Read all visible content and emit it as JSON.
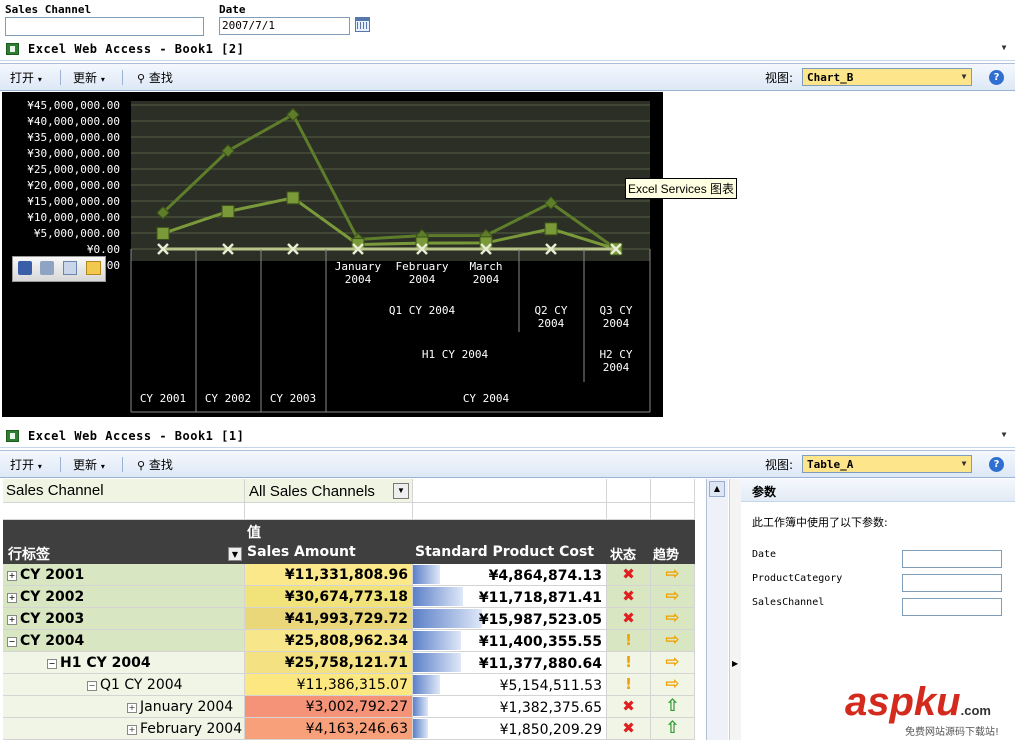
{
  "filters": {
    "sales_channel_label": "Sales Channel",
    "sales_channel_value": "",
    "date_label": "Date",
    "date_value": "2007/7/1"
  },
  "window1": {
    "title": "Excel Web Access - Book1 [2]",
    "toolbar": {
      "open": "打开",
      "refresh": "更新",
      "find": "查找",
      "view_label": "视图:",
      "view_value": "Chart_B"
    },
    "tooltip": "Excel Services 图表"
  },
  "window2": {
    "title": "Excel Web Access - Book1 [1]",
    "toolbar": {
      "open": "打开",
      "refresh": "更新",
      "find": "查找",
      "view_label": "视图:",
      "view_value": "Table_A"
    }
  },
  "chart_data": {
    "type": "line",
    "y_ticks": [
      "¥45,000,000.00",
      "¥40,000,000.00",
      "¥35,000,000.00",
      "¥30,000,000.00",
      "¥25,000,000.00",
      "¥20,000,000.00",
      "¥15,000,000.00",
      "¥10,000,000.00",
      "¥5,000,000.00",
      "¥0.00",
      "00"
    ],
    "ylim": [
      0,
      45000000
    ],
    "categories": [
      "CY 2001",
      "CY 2002",
      "CY 2003",
      "January 2004",
      "February 2004",
      "March 2004",
      "Q2 CY 2004",
      "Q3 CY 2004"
    ],
    "series": [
      {
        "marker": "diamond",
        "color": "#5e7d2a",
        "values": [
          11331808.96,
          30674773.18,
          41993729.72,
          3002792.27,
          4163246.63,
          4220276.17,
          14400000,
          50000
        ]
      },
      {
        "marker": "square",
        "color": "#7a9a3a",
        "values": [
          4864874.13,
          11718871.41,
          15987523.05,
          1382375.65,
          1850209.29,
          1921926.13,
          6300000,
          22000
        ]
      },
      {
        "marker": "x",
        "color": "#b8c48a",
        "values": [
          0,
          0,
          0,
          0,
          0,
          0,
          0,
          0
        ]
      }
    ],
    "x_level1": [
      {
        "text": "January\n2004"
      },
      {
        "text": "February\n2004"
      },
      {
        "text": "March\n2004"
      }
    ],
    "x_level2": [
      {
        "text": "Q1 CY 2004"
      },
      {
        "text": "Q2 CY\n2004"
      },
      {
        "text": "Q3 CY\n2004"
      }
    ],
    "x_level3": [
      {
        "text": "H1 CY 2004"
      },
      {
        "text": "H2 CY\n2004"
      }
    ],
    "x_level4": [
      {
        "text": "CY 2001"
      },
      {
        "text": "CY 2002"
      },
      {
        "text": "CY 2003"
      },
      {
        "text": "CY 2004"
      }
    ]
  },
  "table": {
    "filter_label": "Sales Channel",
    "filter_value": "All Sales Channels",
    "values_header": "值",
    "row_label_header": "行标签",
    "col_sales": "Sales Amount",
    "col_cost": "Standard Product Cost",
    "col_status": "状态",
    "col_trend": "趋势",
    "rows": [
      {
        "label": "CY 2001",
        "exp": "+",
        "sales": "¥11,331,808.96",
        "cost": "¥4,864,874.13",
        "status": "✖",
        "trend": "⇨",
        "bold": true,
        "level": 0
      },
      {
        "label": "CY 2002",
        "exp": "+",
        "sales": "¥30,674,773.18",
        "cost": "¥11,718,871.41",
        "status": "✖",
        "trend": "⇨",
        "bold": true,
        "level": 0
      },
      {
        "label": "CY 2003",
        "exp": "+",
        "sales": "¥41,993,729.72",
        "cost": "¥15,987,523.05",
        "status": "✖",
        "trend": "⇨",
        "bold": true,
        "level": 0
      },
      {
        "label": "CY 2004",
        "exp": "−",
        "sales": "¥25,808,962.34",
        "cost": "¥11,400,355.55",
        "status": "!",
        "trend": "⇨",
        "bold": true,
        "level": 0
      },
      {
        "label": "H1 CY 2004",
        "exp": "−",
        "sales": "¥25,758,121.71",
        "cost": "¥11,377,880.64",
        "status": "!",
        "trend": "⇨",
        "bold": true,
        "level": 1
      },
      {
        "label": "Q1 CY 2004",
        "exp": "−",
        "sales": "¥11,386,315.07",
        "cost": "¥5,154,511.53",
        "status": "!",
        "trend": "⇨",
        "bold": false,
        "level": 2
      },
      {
        "label": "January 2004",
        "exp": "+",
        "sales": "¥3,002,792.27",
        "cost": "¥1,382,375.65",
        "status": "✖",
        "trend": "⇧",
        "bold": false,
        "level": 3
      },
      {
        "label": "February 2004",
        "exp": "+",
        "sales": "¥4,163,246.63",
        "cost": "¥1,850,209.29",
        "status": "✖",
        "trend": "⇧",
        "bold": false,
        "level": 3
      }
    ]
  },
  "params_panel": {
    "title": "参数",
    "desc": "此工作簿中使用了以下参数:",
    "params": [
      "Date",
      "ProductCategory",
      "SalesChannel"
    ]
  },
  "watermark": {
    "text": "aspku",
    "suffix": ".com",
    "sub": "免费网站源码下载站!"
  }
}
